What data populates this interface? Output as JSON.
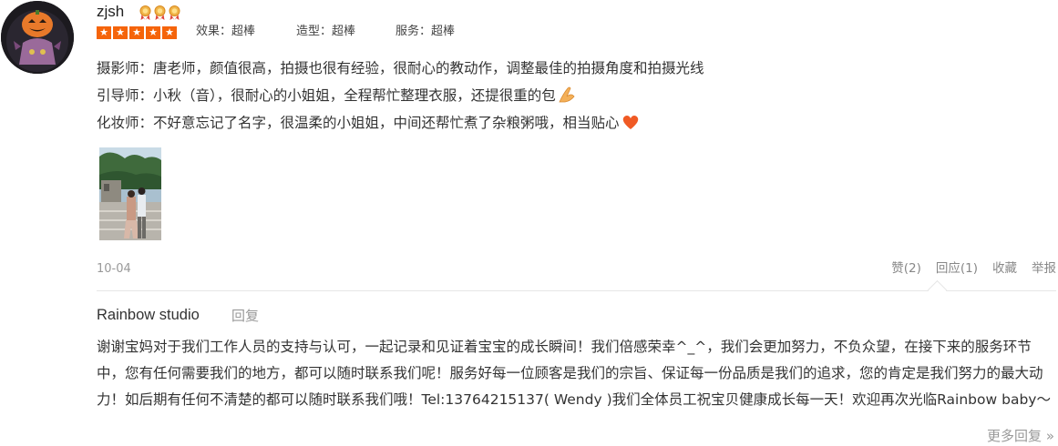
{
  "review": {
    "username": "zjsh",
    "medal_count": 3,
    "rating_stars": 5,
    "scores": [
      {
        "label": "效果：超棒"
      },
      {
        "label": "造型：超棒"
      },
      {
        "label": "服务：超棒"
      }
    ],
    "lines": [
      "摄影师：唐老师，颜值很高，拍摄也很有经验，很耐心的教动作，调整最佳的拍摄角度和拍摄光线",
      "引导师：小秋（音），很耐心的小姐姐，全程帮忙整理衣服，还提很重的包",
      "化妆师：不好意忘记了名字，很温柔的小姐姐，中间还帮忙煮了杂粮粥哦，相当贴心"
    ],
    "date": "10-04",
    "actions": {
      "like": "赞(2)",
      "reply": "回应(1)",
      "collect": "收藏",
      "report": "举报"
    }
  },
  "reply": {
    "author": "Rainbow studio",
    "reply_link": "回复",
    "text": "谢谢宝妈对于我们工作人员的支持与认可，一起记录和见证着宝宝的成长瞬间！我们倍感荣幸^_^，我们会更加努力，不负众望，在接下来的服务环节中，您有任何需要我们的地方，都可以随时联系我们呢！服务好每一位顾客是我们的宗旨、保证每一份品质是我们的追求，您的肯定是我们努力的最大动力！如后期有任何不清楚的都可以随时联系我们哦！Tel:13764215137( Wendy )我们全体员工祝宝贝健康成长每一天！欢迎再次光临Rainbow baby～",
    "more": "更多回复 »"
  },
  "colors": {
    "star": "#f5640a",
    "muted": "#999999",
    "text": "#333333"
  }
}
